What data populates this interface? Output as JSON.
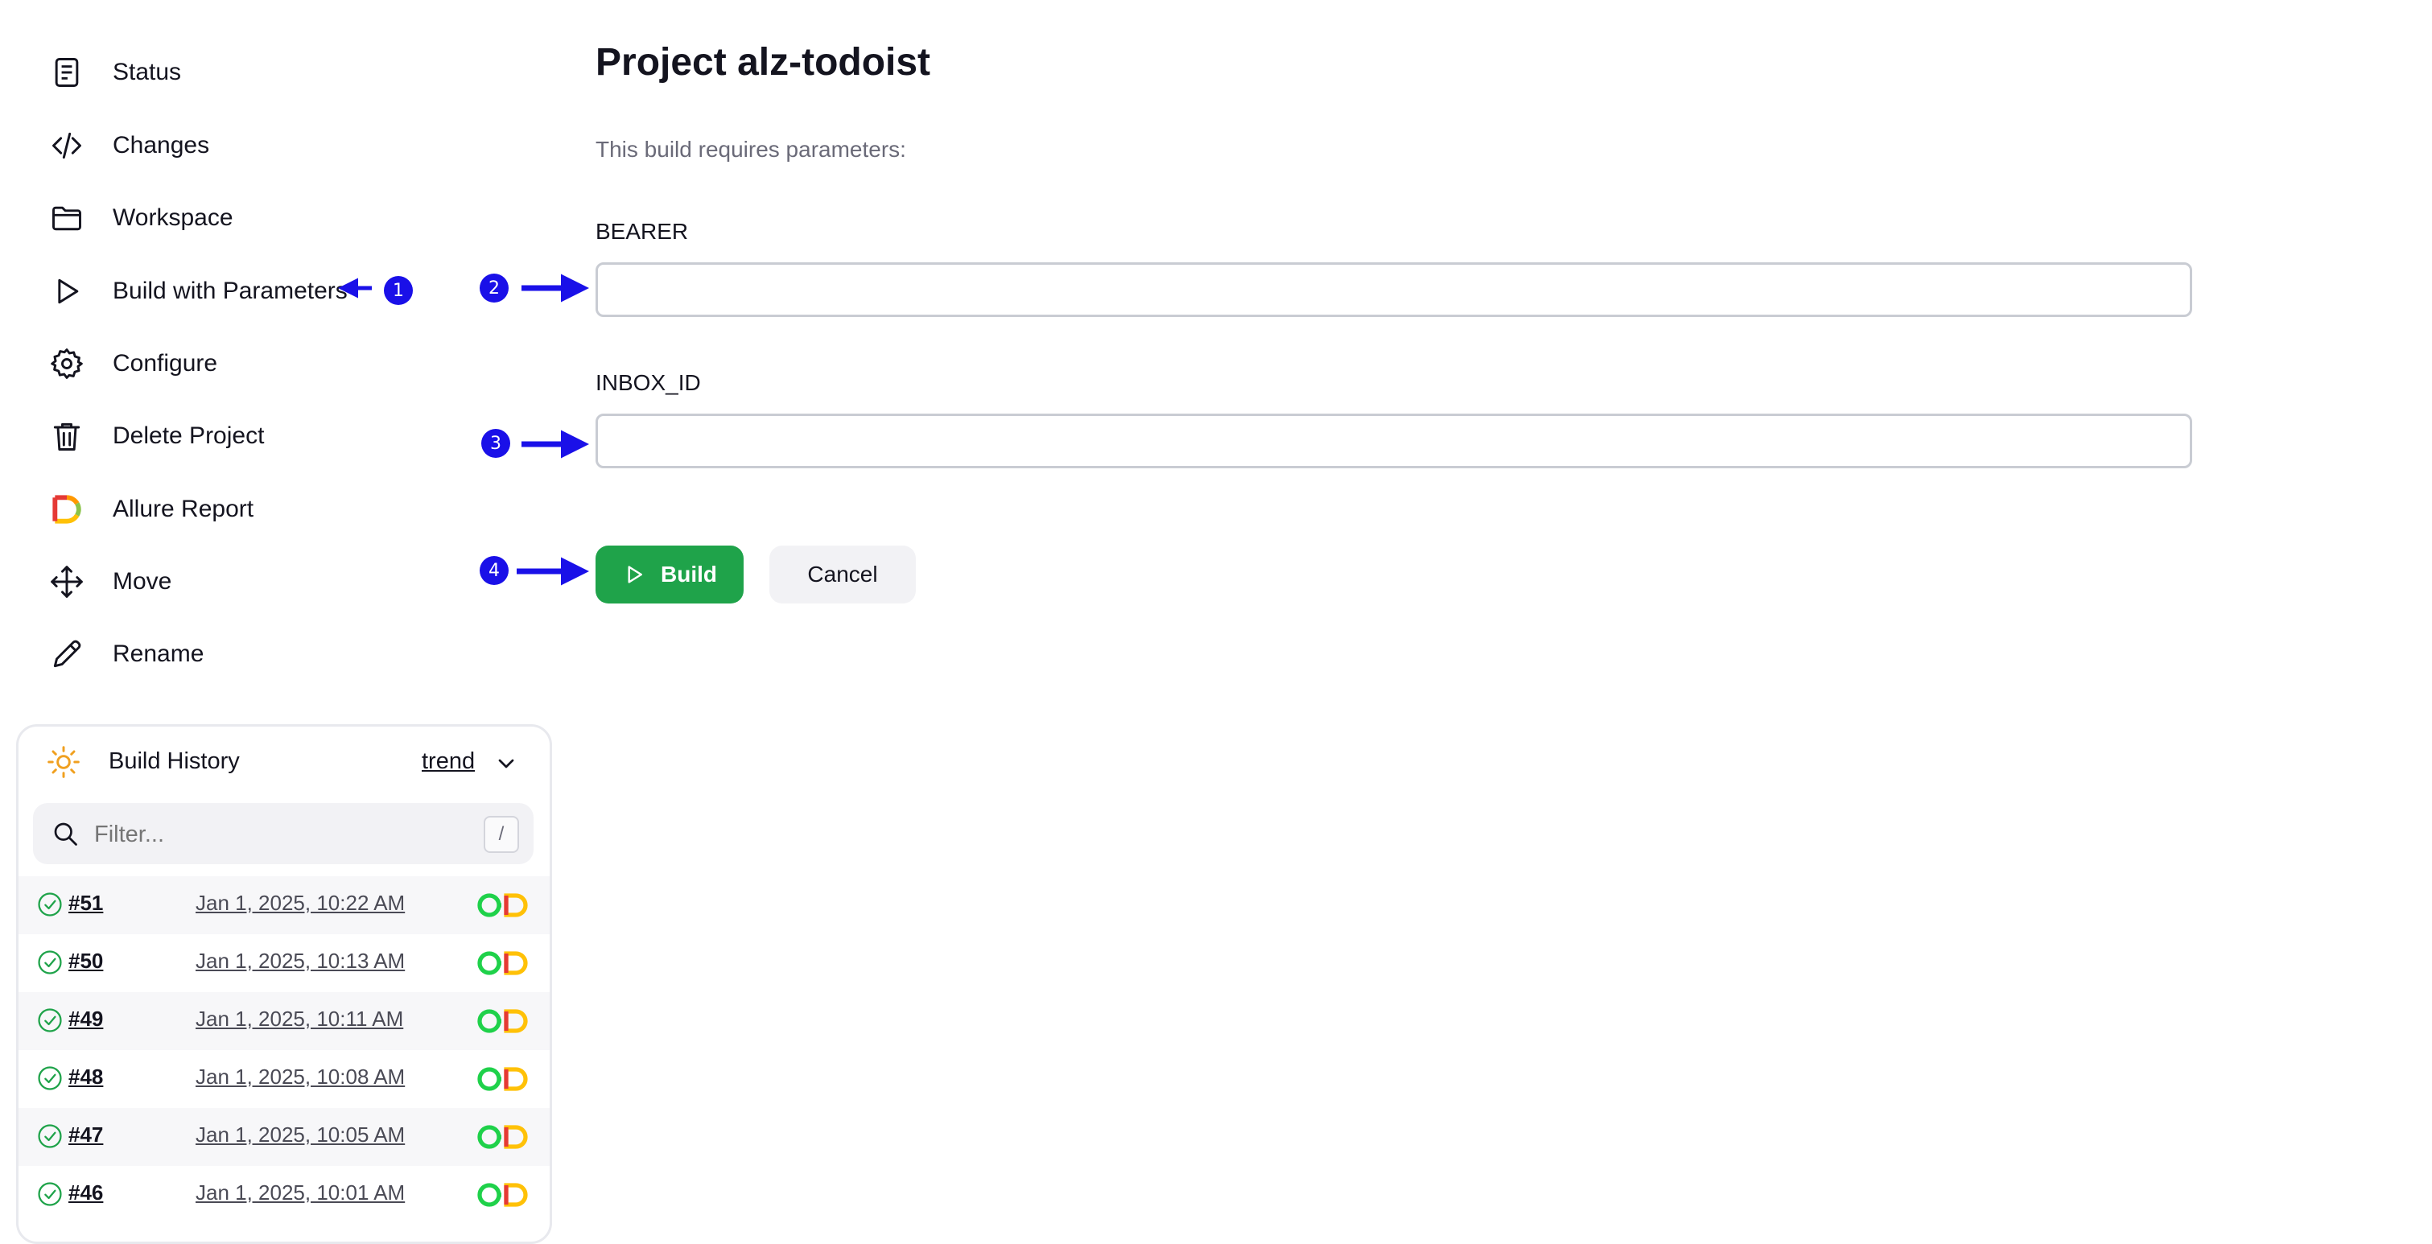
{
  "sidebar": {
    "items": [
      {
        "label": "Status",
        "icon": "document-icon"
      },
      {
        "label": "Changes",
        "icon": "code-icon"
      },
      {
        "label": "Workspace",
        "icon": "folder-icon"
      },
      {
        "label": "Build with Parameters",
        "icon": "play-icon"
      },
      {
        "label": "Configure",
        "icon": "gear-icon"
      },
      {
        "label": "Delete Project",
        "icon": "trash-icon"
      },
      {
        "label": "Allure Report",
        "icon": "allure-icon"
      },
      {
        "label": "Move",
        "icon": "move-arrows-icon"
      },
      {
        "label": "Rename",
        "icon": "pencil-icon"
      }
    ]
  },
  "history": {
    "title": "Build History",
    "trend_label": "trend",
    "filter_placeholder": "Filter...",
    "filter_shortcut": "/",
    "rows": [
      {
        "number": "#51",
        "date": "Jan 1, 2025, 10:22 AM"
      },
      {
        "number": "#50",
        "date": "Jan 1, 2025, 10:13 AM"
      },
      {
        "number": "#49",
        "date": "Jan 1, 2025, 10:11 AM"
      },
      {
        "number": "#48",
        "date": "Jan 1, 2025, 10:08 AM"
      },
      {
        "number": "#47",
        "date": "Jan 1, 2025, 10:05 AM"
      },
      {
        "number": "#46",
        "date": "Jan 1, 2025, 10:01 AM"
      }
    ]
  },
  "main": {
    "title": "Project alz-todoist",
    "description": "This build requires parameters:",
    "params": [
      {
        "name": "BEARER",
        "value": ""
      },
      {
        "name": "INBOX_ID",
        "value": ""
      }
    ],
    "build_label": "Build",
    "cancel_label": "Cancel"
  },
  "annotations": {
    "badges": [
      "1",
      "2",
      "3",
      "4"
    ],
    "color": "#1a10e8"
  },
  "colors": {
    "build_green": "#1fa34a",
    "success_green": "#1fa34a"
  }
}
